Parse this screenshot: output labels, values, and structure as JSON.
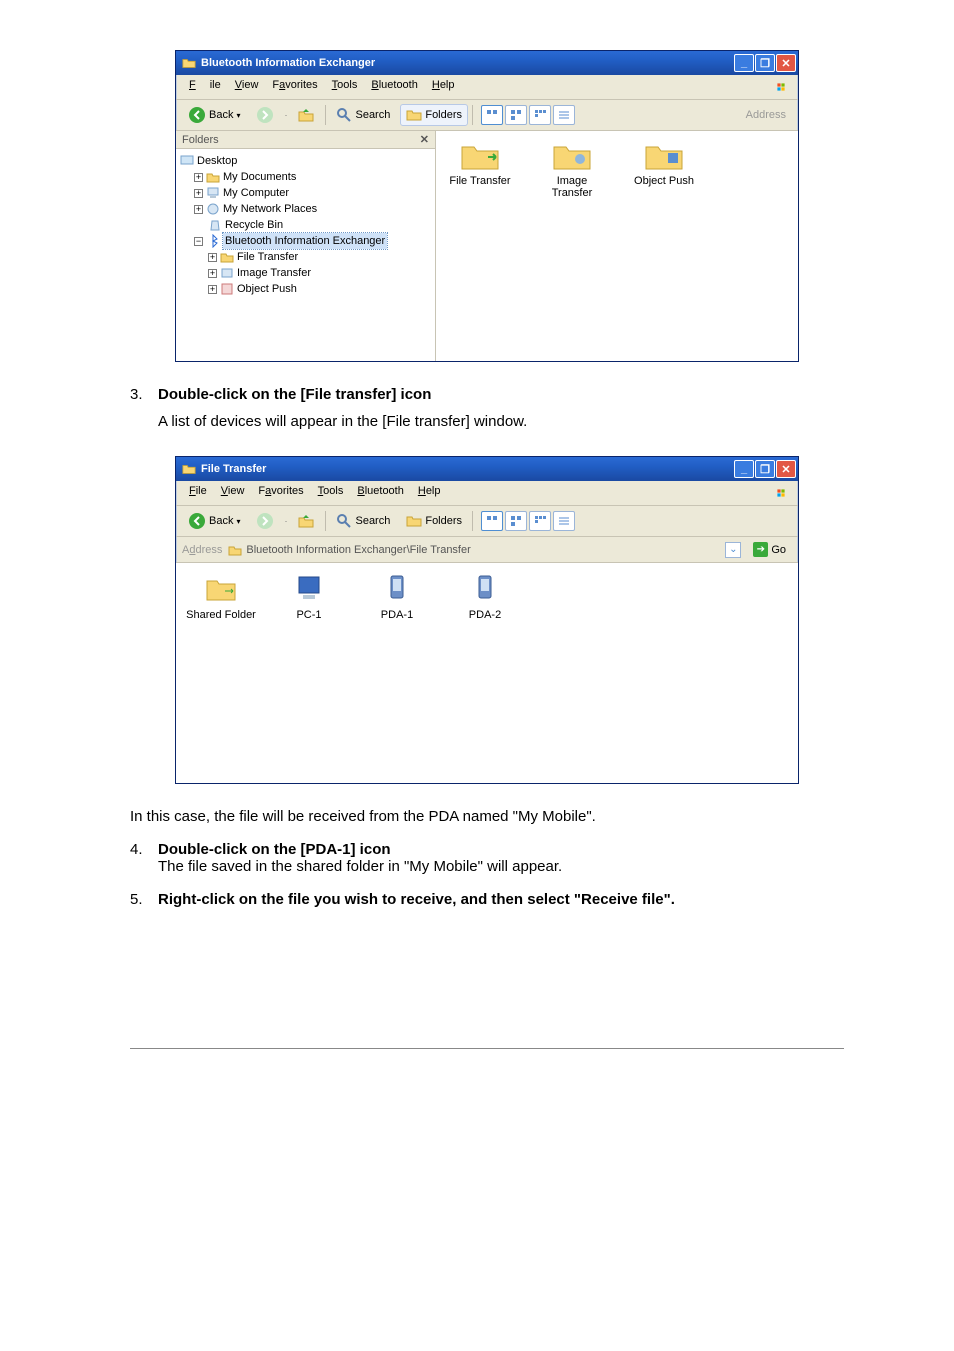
{
  "fig1": {
    "title": "Bluetooth Information Exchanger",
    "menu": [
      "File",
      "View",
      "Favorites",
      "Tools",
      "Bluetooth",
      "Help"
    ],
    "back": "Back",
    "search": "Search",
    "folders": "Folders",
    "address": "Address",
    "folders_hdr": "Folders",
    "tree": {
      "desktop": "Desktop",
      "mydocs": "My Documents",
      "mycomp": "My Computer",
      "mynet": "My Network Places",
      "recycle": "Recycle Bin",
      "btex": "Bluetooth Information Exchanger",
      "ft": "File Transfer",
      "it": "Image Transfer",
      "op": "Object Push"
    },
    "icons": {
      "ft": "File Transfer",
      "it": "Image\nTransfer",
      "op": "Object Push"
    }
  },
  "step3": {
    "num": "3.",
    "bold": "Double-click on the [File transfer] icon",
    "desc": "A list of devices will appear in the [File transfer] window."
  },
  "fig2": {
    "title": "File Transfer",
    "menu": [
      "File",
      "View",
      "Favorites",
      "Tools",
      "Bluetooth",
      "Help"
    ],
    "back": "Back",
    "search": "Search",
    "folders": "Folders",
    "address_lbl": "Address",
    "path": "Bluetooth Information Exchanger\\File Transfer",
    "go": "Go",
    "items": {
      "shared": "Shared Folder",
      "pc1": "PC-1",
      "pda1": "PDA-1",
      "pda2": "PDA-2"
    }
  },
  "after_fig2": "In this case, the file will be received from the PDA named \"My Mobile\".",
  "step4": {
    "num": "4.",
    "bold": "Double-click on the [PDA-1] icon",
    "desc": "The file saved in the shared folder in \"My Mobile\" will appear."
  },
  "step5": {
    "num": "5.",
    "bold": "Right-click on the file you wish to receive, and then select \"Receive file\"."
  }
}
